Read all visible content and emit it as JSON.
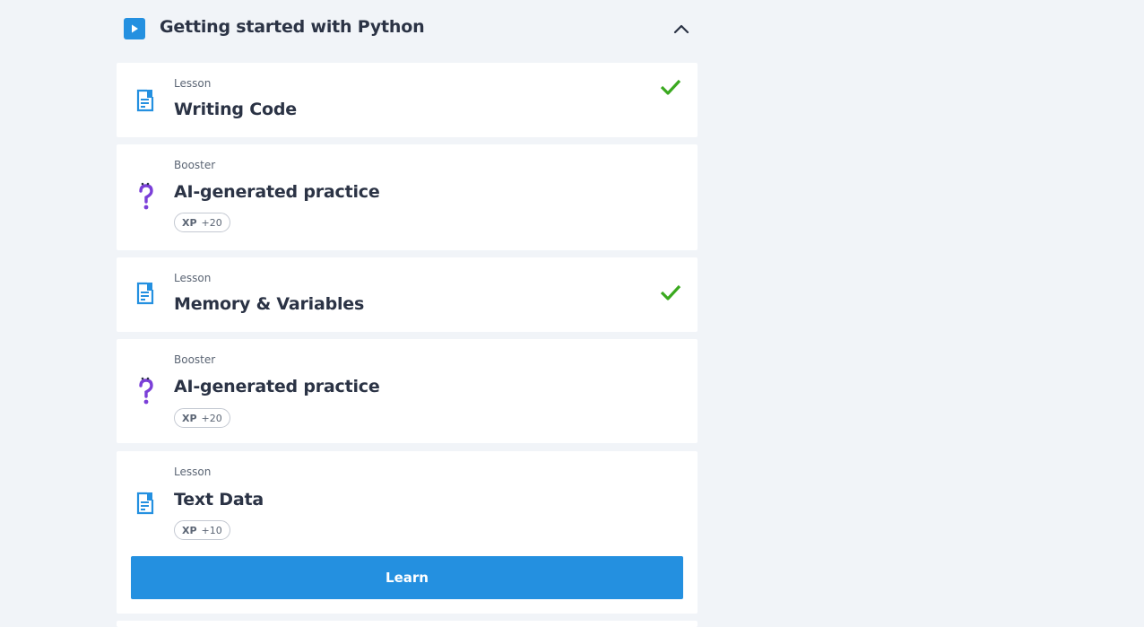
{
  "chapter": {
    "title": "Getting started with Python",
    "play_icon": "play-icon",
    "toggle_icon": "chevron-up-icon"
  },
  "items": [
    {
      "kind": "Lesson",
      "title": "Writing Code",
      "completed": true,
      "icon": "lesson-document-icon"
    },
    {
      "kind": "Booster",
      "title": "AI-generated practice",
      "xp_label": "XP",
      "xp_value": "+20",
      "icon": "question-mark-icon"
    },
    {
      "kind": "Lesson",
      "title": "Memory & Variables",
      "completed": true,
      "icon": "lesson-document-icon"
    },
    {
      "kind": "Booster",
      "title": "AI-generated practice",
      "xp_label": "XP",
      "xp_value": "+20",
      "icon": "question-mark-icon"
    },
    {
      "kind": "Lesson",
      "title": "Text Data",
      "xp_label": "XP",
      "xp_value": "+10",
      "icon": "lesson-document-icon",
      "button_label": "Learn"
    }
  ],
  "colors": {
    "accent": "#2490e0",
    "success": "#3aa91f",
    "booster": "#7b3fd8",
    "background": "#f1f4f8"
  }
}
